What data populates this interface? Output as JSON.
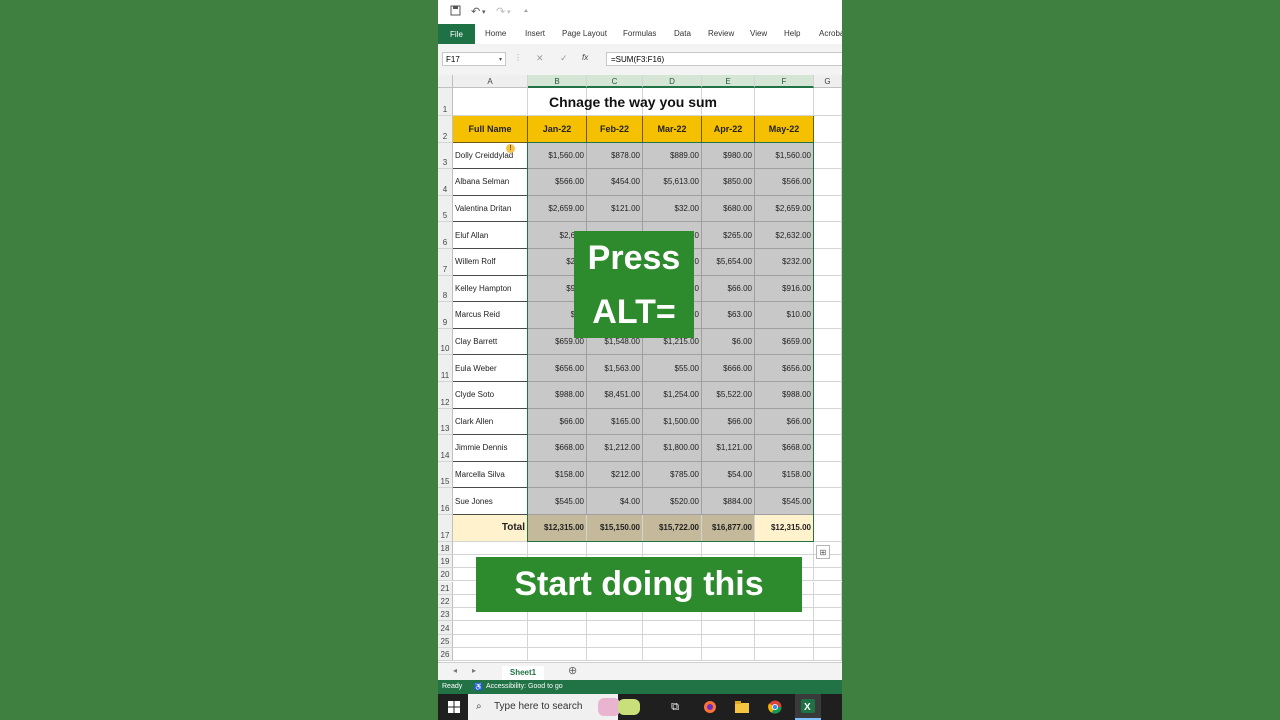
{
  "qat": {
    "save_icon": "save-icon",
    "undo_icon": "undo-icon",
    "redo_icon": "redo-icon"
  },
  "ribbon": {
    "file": "File",
    "tabs": [
      "Home",
      "Insert",
      "Page Layout",
      "Formulas",
      "Data",
      "Review",
      "View",
      "Help",
      "Acroba"
    ]
  },
  "formula_bar": {
    "name_box": "F17",
    "cancel": "✕",
    "enter": "✓",
    "fx": "fx",
    "formula": "=SUM(F3:F16)"
  },
  "columns": [
    "A",
    "B",
    "C",
    "D",
    "E",
    "F",
    "G"
  ],
  "rows": [
    "1",
    "2",
    "3",
    "4",
    "5",
    "6",
    "7",
    "8",
    "9",
    "10",
    "11",
    "12",
    "13",
    "14",
    "15",
    "16",
    "17",
    "18",
    "19",
    "20",
    "21",
    "22",
    "23",
    "24",
    "25",
    "26"
  ],
  "sheet_title": "Chnage the way you sum",
  "headers": [
    "Full Name",
    "Jan-22",
    "Feb-22",
    "Mar-22",
    "Apr-22",
    "May-22"
  ],
  "data": [
    [
      "Dolly Creiddylad",
      "$1,560.00",
      "$878.00",
      "$889.00",
      "$980.00",
      "$1,560.00"
    ],
    [
      "Albana Selman",
      "$566.00",
      "$454.00",
      "$5,613.00",
      "$850.00",
      "$566.00"
    ],
    [
      "Valentina Dritan",
      "$2,659.00",
      "$121.00",
      "$32.00",
      "$680.00",
      "$2,659.00"
    ],
    [
      "Eluf Allan",
      "$2,632",
      "",
      "0",
      "$265.00",
      "$2,632.00"
    ],
    [
      "Willem Rolf",
      "$232",
      "",
      "0",
      "$5,654.00",
      "$232.00"
    ],
    [
      "Kelley Hampton",
      "$916",
      "",
      "0",
      "$66.00",
      "$916.00"
    ],
    [
      "Marcus Reid",
      "$10",
      "",
      "0",
      "$63.00",
      "$10.00"
    ],
    [
      "Clay Barrett",
      "$659.00",
      "$1,548.00",
      "$1,215.00",
      "$6.00",
      "$659.00"
    ],
    [
      "Eula Weber",
      "$656.00",
      "$1,563.00",
      "$55.00",
      "$666.00",
      "$656.00"
    ],
    [
      "Clyde Soto",
      "$988.00",
      "$8,451.00",
      "$1,254.00",
      "$5,522.00",
      "$988.00"
    ],
    [
      "Clark Allen",
      "$66.00",
      "$165.00",
      "$1,500.00",
      "$66.00",
      "$66.00"
    ],
    [
      "Jimmie Dennis",
      "$668.00",
      "$1,212.00",
      "$1,800.00",
      "$1,121.00",
      "$668.00"
    ],
    [
      "Marcella Silva",
      "$158.00",
      "$212.00",
      "$785.00",
      "$54.00",
      "$158.00"
    ],
    [
      "Sue Jones",
      "$545.00",
      "$4.00",
      "$520.00",
      "$884.00",
      "$545.00"
    ]
  ],
  "totals": [
    "Total",
    "$12,315.00",
    "$15,150.00",
    "$15,722.00",
    "$16,877.00",
    "$12,315.00"
  ],
  "overlay": {
    "press_line1": "Press",
    "press_line2": "ALT=",
    "start": "Start doing this"
  },
  "sheet_tabs": {
    "active": "Sheet1",
    "add": "⊕"
  },
  "status": {
    "ready": "Ready",
    "accessibility": "Accessibility: Good to go"
  },
  "taskbar": {
    "search_placeholder": "Type here to search"
  },
  "colors": {
    "excel_green": "#217346",
    "header_yellow": "#f5c000",
    "overlay_green": "#2d8a2d",
    "background": "#3f7f3f"
  }
}
